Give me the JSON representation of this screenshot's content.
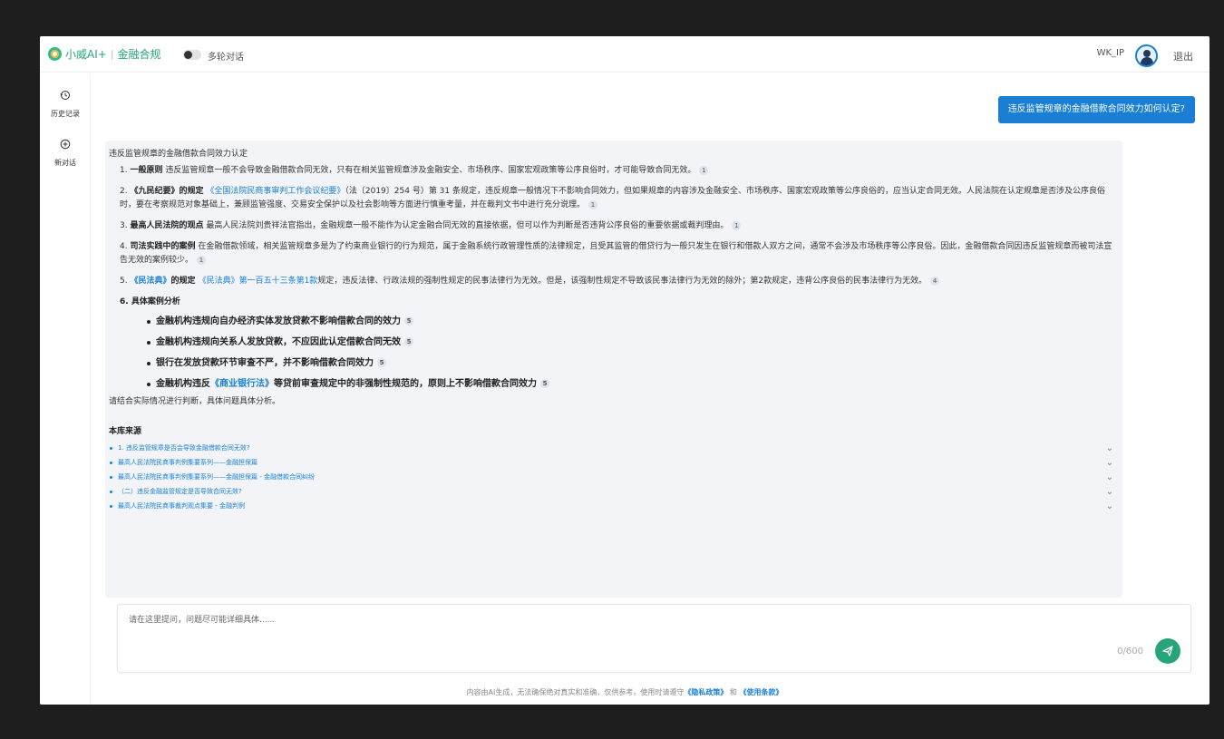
{
  "header": {
    "brand": "小威AI+",
    "separator": "|",
    "module": "金融合规",
    "multi_turn_label": "多轮对话",
    "username": "WK_IP",
    "logout_label": "退出"
  },
  "sidebar": {
    "items": [
      {
        "label": "历史记录",
        "icon": "history-icon"
      },
      {
        "label": "新对话",
        "icon": "new-chat-icon"
      }
    ]
  },
  "chat": {
    "question": "违反监管规章的金融借款合同效力如何认定?",
    "answer": {
      "intro": "违反监管规章的金融借款合同效力认定",
      "items": [
        {
          "num": "1.",
          "title": "一般原则",
          "pre": "",
          "link": "",
          "text": " 违反监管规章一般不会导致金融借款合同无效，只有在相关监管规章涉及金融安全、市场秩序、国家宏观政策等公序良俗时，才可能导致合同无效。",
          "ref": "1"
        },
        {
          "num": "2.",
          "title": "《九民纪要》的规定",
          "pre": " ",
          "link": "《全国法院民商事审判工作会议纪要》",
          "text": "（法〔2019〕254 号）第 31 条规定，违反规章一般情况下不影响合同效力，但如果规章的内容涉及金融安全、市场秩序、国家宏观政策等公序良俗的，应当认定合同无效。人民法院在认定规章是否涉及公序良俗时，要在考察规范对象基础上，兼顾监管强度、交易安全保护以及社会影响等方面进行慎重考量，并在裁判文书中进行充分说理。",
          "ref": "1"
        },
        {
          "num": "3.",
          "title": "最高人民法院的观点",
          "pre": "",
          "link": "",
          "text": " 最高人民法院刘贵祥法官指出，金融规章一般不能作为认定金融合同无效的直接依据，但可以作为判断是否违背公序良俗的重要依据或裁判理由。",
          "ref": "1"
        },
        {
          "num": "4.",
          "title": "司法实践中的案例",
          "pre": "",
          "link": "",
          "text": " 在金融借款领域，相关监管规章多是为了约束商业银行的行为规范，属于金融系统行政管理性质的法律规定，且受其监管的借贷行为一般只发生在银行和借款人双方之间，通常不会涉及市场秩序等公序良俗。因此，金融借款合同因违反监管规章而被司法宣告无效的案例较少。",
          "ref": "1"
        },
        {
          "num": "5.",
          "title": "",
          "pre": "",
          "link": "《民法典》",
          "text": "的规定 ",
          "link2": "《民法典》第一百五十三条第1款",
          "text2": "规定，违反法律、行政法规的强制性规定的民事法律行为无效。但是，该强制性规定不导致该民事法律行为无效的除外；第2款规定，违背公序良俗的民事法律行为无效。",
          "ref": "4"
        }
      ],
      "cases_title": "6. 具体案例分析",
      "cases": [
        {
          "pre": "金融机构违规向自办经济实体发放贷款不影响借款合同的效力",
          "link": "",
          "post": "",
          "ref": "5"
        },
        {
          "pre": "金融机构违规向关系人发放贷款，不应因此认定借款合同无效",
          "link": "",
          "post": "",
          "ref": "5"
        },
        {
          "pre": "银行在发放贷款环节审查不严，并不影响借款合同效力",
          "link": "",
          "post": "",
          "ref": "5"
        },
        {
          "pre": "金融机构违反",
          "link": "《商业银行法》",
          "post": "等贷前审查规定中的非强制性规范的，原则上不影响借款合同效力",
          "ref": "5"
        }
      ],
      "closing": "请结合实际情况进行判断，具体问题具体分析。",
      "sources_title": "本库来源",
      "sources": [
        "1. 违反监管规章是否会导致金融借款合同无效?",
        "最高人民法院民商事判例集要系列——金融担保篇",
        "最高人民法院民商事判例集要系列——金融担保篇 - 金融借款合同纠纷",
        "（二）违反金融监管规定是否导致合同无效?",
        "最高人民法院民商事裁判观点集要 - 金融判例"
      ]
    }
  },
  "input": {
    "placeholder": "请在这里提问，问题尽可能详细具体......",
    "value": "",
    "counter": "0/600"
  },
  "footer": {
    "text": "内容由AI生成，无法确保绝对真实和准确，仅供参考。使用时请遵守",
    "privacy": "《隐私政策》",
    "and": " 和 ",
    "terms": "《使用条款》"
  },
  "colors": {
    "accent_blue": "#1a7fd4",
    "accent_green": "#27a57a",
    "answer_bg": "#f2f4f7"
  }
}
